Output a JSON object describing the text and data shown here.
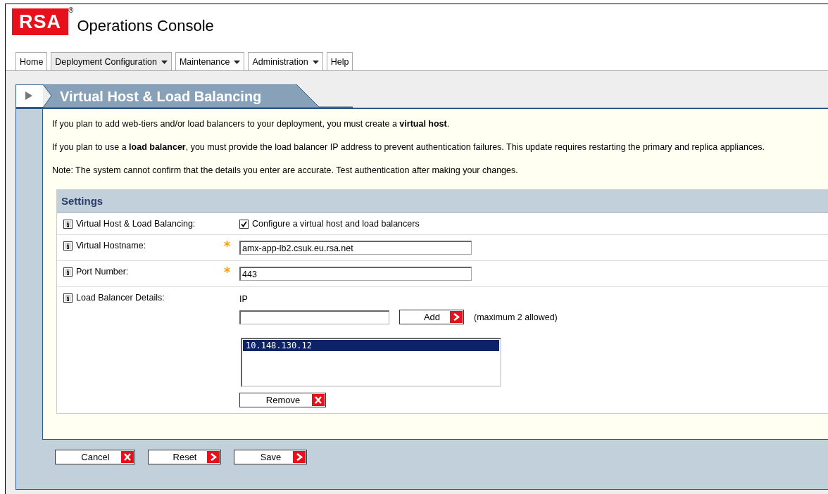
{
  "header": {
    "logo": "RSA",
    "logo_mark": "®",
    "title": "Operations Console"
  },
  "nav_tabs": [
    {
      "label": "Home",
      "dropdown": false,
      "selected": false
    },
    {
      "label": "Deployment Configuration",
      "dropdown": true,
      "selected": true
    },
    {
      "label": "Maintenance",
      "dropdown": true,
      "selected": false
    },
    {
      "label": "Administration",
      "dropdown": true,
      "selected": false
    },
    {
      "label": "Help",
      "dropdown": false,
      "selected": false
    }
  ],
  "page_heading": "Virtual Host & Load Balancing",
  "intro": [
    "If you plan to add web-tiers and/or load balancers to your deployment, you must create a **virtual host**.",
    "If you plan to use a **load balancer**, you must provide the load balancer IP address to prevent authentication failures. This update requires restarting the primary and replica appliances.",
    "Note: The system cannot confirm that the details you enter are accurate. Test authentication after making your changes."
  ],
  "settings": {
    "title": "Settings",
    "rows": [
      {
        "kind": "checkbox",
        "label": "Virtual Host & Load Balancing:",
        "checked": true,
        "text": "Configure a virtual host and load balancers"
      },
      {
        "kind": "text",
        "label": "Virtual Hostname:",
        "required": true,
        "value": "amx-app-lb2.csuk.eu.rsa.net"
      },
      {
        "kind": "text",
        "label": "Port Number:",
        "required": true,
        "value": "443"
      },
      {
        "kind": "ip_list",
        "label": "Load Balancer Details:",
        "field_label": "IP",
        "add_button": "Add",
        "note": "(maximum 2 allowed)",
        "items": [
          {
            "text": "10.148.130.12",
            "selected": true
          }
        ],
        "remove_button": "Remove"
      }
    ]
  },
  "footer_buttons": [
    {
      "label": "Cancel",
      "kind": "cancel"
    },
    {
      "label": "Reset",
      "kind": "next"
    },
    {
      "label": "Save",
      "kind": "next"
    }
  ]
}
